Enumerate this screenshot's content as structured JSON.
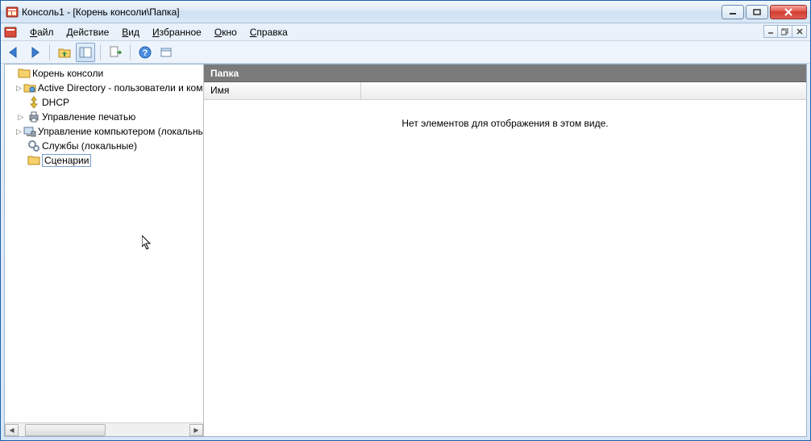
{
  "window": {
    "title": "Консоль1 - [Корень консоли\\Папка]"
  },
  "menu": {
    "file": "Файл",
    "action": "Действие",
    "view": "Вид",
    "favorites": "Избранное",
    "window": "Окно",
    "help": "Справка"
  },
  "tree": {
    "root": "Корень консоли",
    "items": [
      {
        "label": "Active Directory - пользователи и компьютеры",
        "icon": "ad-users-icon",
        "expandable": true
      },
      {
        "label": "DHCP",
        "icon": "dhcp-icon",
        "expandable": false
      },
      {
        "label": "Управление печатью",
        "icon": "print-mgmt-icon",
        "expandable": true
      },
      {
        "label": "Управление компьютером (локальным)",
        "icon": "computer-mgmt-icon",
        "expandable": true
      },
      {
        "label": "Службы (локальные)",
        "icon": "services-icon",
        "expandable": false
      },
      {
        "label": "Сценарии",
        "icon": "folder-icon",
        "expandable": false,
        "editing": true
      }
    ]
  },
  "content": {
    "header": "Папка",
    "column_name": "Имя",
    "empty_text": "Нет элементов для отображения в этом виде."
  }
}
